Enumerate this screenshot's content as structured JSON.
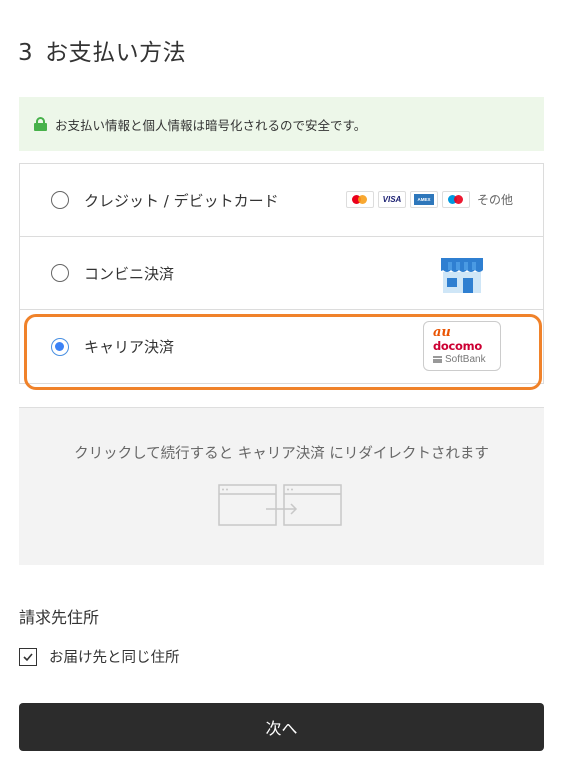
{
  "section": {
    "number": "3",
    "title": "お支払い方法"
  },
  "security_notice": {
    "icon": "lock-icon",
    "text": "お支払い情報と個人情報は暗号化されるので安全です。"
  },
  "payment_methods": [
    {
      "label": "クレジット / デビットカード",
      "selected": false,
      "card_brands": [
        "mastercard",
        "VISA",
        "amex",
        "maestro"
      ],
      "others_label": "その他"
    },
    {
      "label": "コンビニ決済",
      "selected": false,
      "icon": "convenience-store-icon"
    },
    {
      "label": "キャリア決済",
      "selected": true,
      "carriers": {
        "au": "au",
        "docomo": "docomo",
        "softbank": "SoftBank"
      }
    }
  ],
  "redirect": {
    "text": "クリックして続行すると キャリア決済 にリダイレクトされます"
  },
  "billing": {
    "title": "請求先住所",
    "same_as_shipping_label": "お届け先と同じ住所",
    "same_as_shipping_checked": true
  },
  "next_button": {
    "label": "次へ"
  },
  "colors": {
    "accent_highlight": "#f0822a",
    "secure_green": "#47b14a",
    "button_bg": "#2c2c2c",
    "radio_selected": "#3b82f6"
  }
}
